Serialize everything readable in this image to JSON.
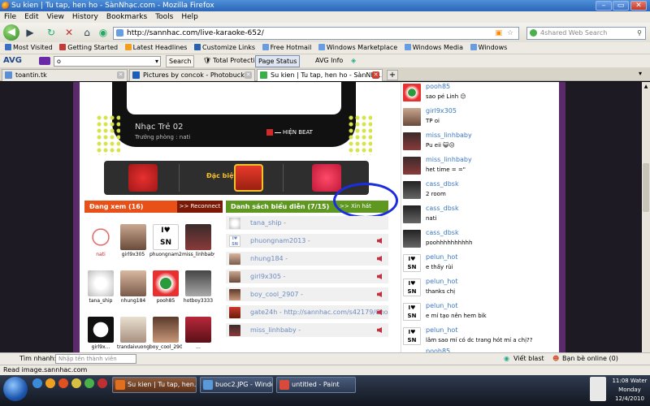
{
  "window": {
    "title": "Su kien | Tu tap, hen ho - SànNhạc.com - Mozilla Firefox",
    "min": "–",
    "max": "▭",
    "close": "✕"
  },
  "menu": [
    "File",
    "Edit",
    "View",
    "History",
    "Bookmarks",
    "Tools",
    "Help"
  ],
  "nav": {
    "url": "http://sannhac.com/live-karaoke-652/",
    "search_placeholder": "4shared Web Search"
  },
  "bookmarks": [
    "Most Visited",
    "Getting Started",
    "Latest Headlines",
    "Customize Links",
    "Free Hotmail",
    "Windows Marketplace",
    "Windows Media",
    "Windows"
  ],
  "avg": {
    "logo": "AVG",
    "search_value": "o",
    "search_btn": "Search",
    "total_protection": "Total Protection",
    "page_status": "Page Status",
    "avg_info": "AVG Info"
  },
  "tabs": [
    "toantin.tk",
    "Pictures by concok - Photobucket",
    "Su kien | Tu tap, hen ho - SànNhạ..."
  ],
  "tv": {
    "title": "Nhạc Trẻ 02",
    "subtitle": "Trưởng phòng : nati",
    "beat": "HIỆN BEAT"
  },
  "gift": {
    "label": "Đặc biệt"
  },
  "viewers": {
    "header": "Đang xem (16)",
    "reconnect": ">> Reconnect",
    "items": [
      "nati",
      "girl9x305",
      "phuongnam2013",
      "miss_linhbaby",
      "tana_ship",
      "nhung184",
      "pooh85",
      "hotboy3333",
      "girl9x...",
      "trandaivuong...",
      "boy_cool_2907",
      "..."
    ]
  },
  "performers": {
    "header": "Danh sách biểu diễn (7/15)",
    "sing": ">> Xin hát",
    "items": [
      "tana_ship",
      "phuongnam2013",
      "nhung184",
      "girl9x305",
      "boy_cool_2907",
      "gate24h - http://sannhac.com/s42179/Chon-di...",
      "miss_linhbaby"
    ],
    "suffix": " -"
  },
  "chat": [
    {
      "name": "pooh85",
      "text": "sao pé Linh 😕"
    },
    {
      "name": "girl9x305",
      "text": "TP oi"
    },
    {
      "name": "miss_linhbaby",
      "text": "Pu eii 😺😐"
    },
    {
      "name": "miss_linhbaby",
      "text": "het time = =\""
    },
    {
      "name": "cass_dbsk",
      "text": "2 room"
    },
    {
      "name": "cass_dbsk",
      "text": "nati"
    },
    {
      "name": "cass_dbsk",
      "text": "poohhhhhhhhhh"
    },
    {
      "name": "pelun_hot",
      "text": "e thấy rùi"
    },
    {
      "name": "pelun_hot",
      "text": "thanks chị"
    },
    {
      "name": "pelun_hot",
      "text": "e mí tạo nên hem bik"
    },
    {
      "name": "pelun_hot",
      "text": "lâm sao mí có dc trang hót mí a chị??"
    },
    {
      "name": "pooh85",
      "text": ""
    }
  ],
  "findbar": {
    "label": "Tìm nhanh:",
    "placeholder": "Nhập tên thành viên",
    "blast": "Viết blast",
    "friends": "Bạn bè online (0)"
  },
  "status": "Read image.sannhac.com",
  "taskbar": {
    "items": [
      "Su kien | Tu tap, hen...",
      "buoc2.JPG - Window...",
      "untitled - Paint"
    ],
    "time": "11:08 Water",
    "day": "Monday",
    "date": "12/4/2010"
  }
}
